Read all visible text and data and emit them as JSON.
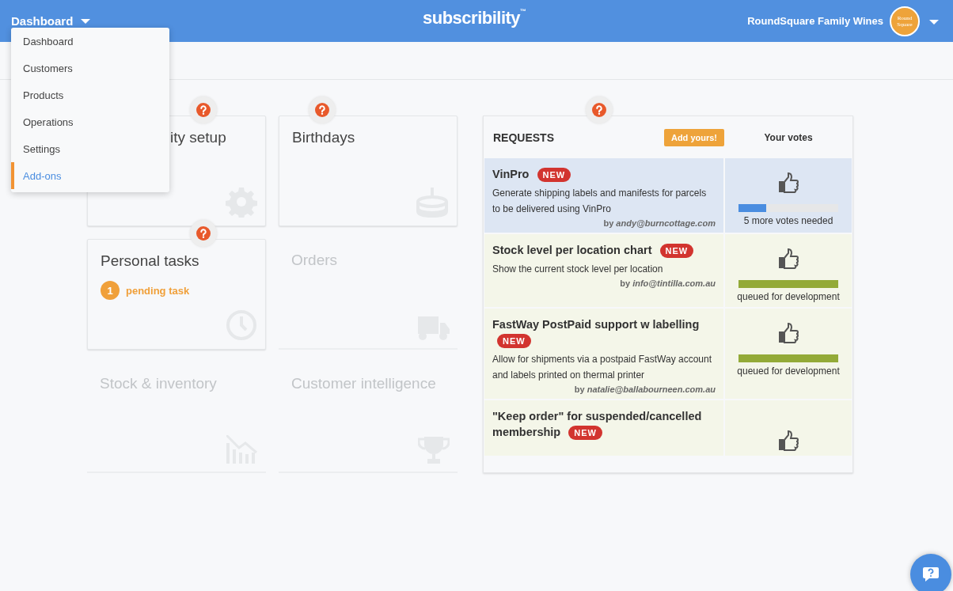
{
  "header": {
    "menu_label": "Dashboard",
    "logo": "subscribility",
    "logo_mark": "™",
    "account": "RoundSquare Family Wines",
    "avatar_lines": [
      "Round",
      "Square"
    ]
  },
  "nav_menu": [
    {
      "label": "Dashboard",
      "selected": false
    },
    {
      "label": "Customers",
      "selected": false
    },
    {
      "label": "Products",
      "selected": false
    },
    {
      "label": "Operations",
      "selected": false
    },
    {
      "label": "Settings",
      "selected": false
    },
    {
      "label": "Add-ons",
      "selected": true
    }
  ],
  "cards": [
    {
      "title": "ity setup",
      "enabled": true,
      "help": true,
      "kind": "gear"
    },
    {
      "title": "Birthdays",
      "enabled": true,
      "help": true,
      "kind": "cake"
    },
    {
      "title": "Personal tasks",
      "enabled": true,
      "help": true,
      "kind": "clock",
      "count": "1",
      "count_label": "pending task"
    },
    {
      "title": "Orders",
      "enabled": false,
      "help": false,
      "kind": "truck"
    },
    {
      "title": "Stock & inventory",
      "enabled": false,
      "help": false,
      "kind": "chart"
    },
    {
      "title": "Customer intelligence",
      "enabled": false,
      "help": false,
      "kind": "trophy"
    }
  ],
  "requests": {
    "title": "REQUESTS",
    "add_button": "Add yours!",
    "votes_heading": "Your votes",
    "items": [
      {
        "title": "VinPro",
        "badge": "NEW",
        "description": "Generate shipping labels and manifests for parcels to be delivered using VinPro",
        "by": "by",
        "author": "andy@burncottage.com",
        "kind": "voting",
        "level": 0.28,
        "status": "5 more votes needed"
      },
      {
        "title": "Stock level per location chart",
        "badge": "NEW",
        "description": "Show the current stock level per location",
        "by": "by",
        "author": "info@tintilla.com.au",
        "kind": "queued",
        "level": 1,
        "status": "queued for development"
      },
      {
        "title": "FastWay PostPaid support w labelling",
        "badge": "NEW",
        "description": "Allow for shipments via a postpaid FastWay account and labels printed on thermal printer",
        "by": "by",
        "author": "natalie@ballabourneen.com.au",
        "kind": "queued",
        "level": 1,
        "status": "queued for development"
      },
      {
        "title": "\"Keep order\" for suspended/cancelled membership",
        "badge": "NEW",
        "kind": "partial"
      }
    ]
  }
}
